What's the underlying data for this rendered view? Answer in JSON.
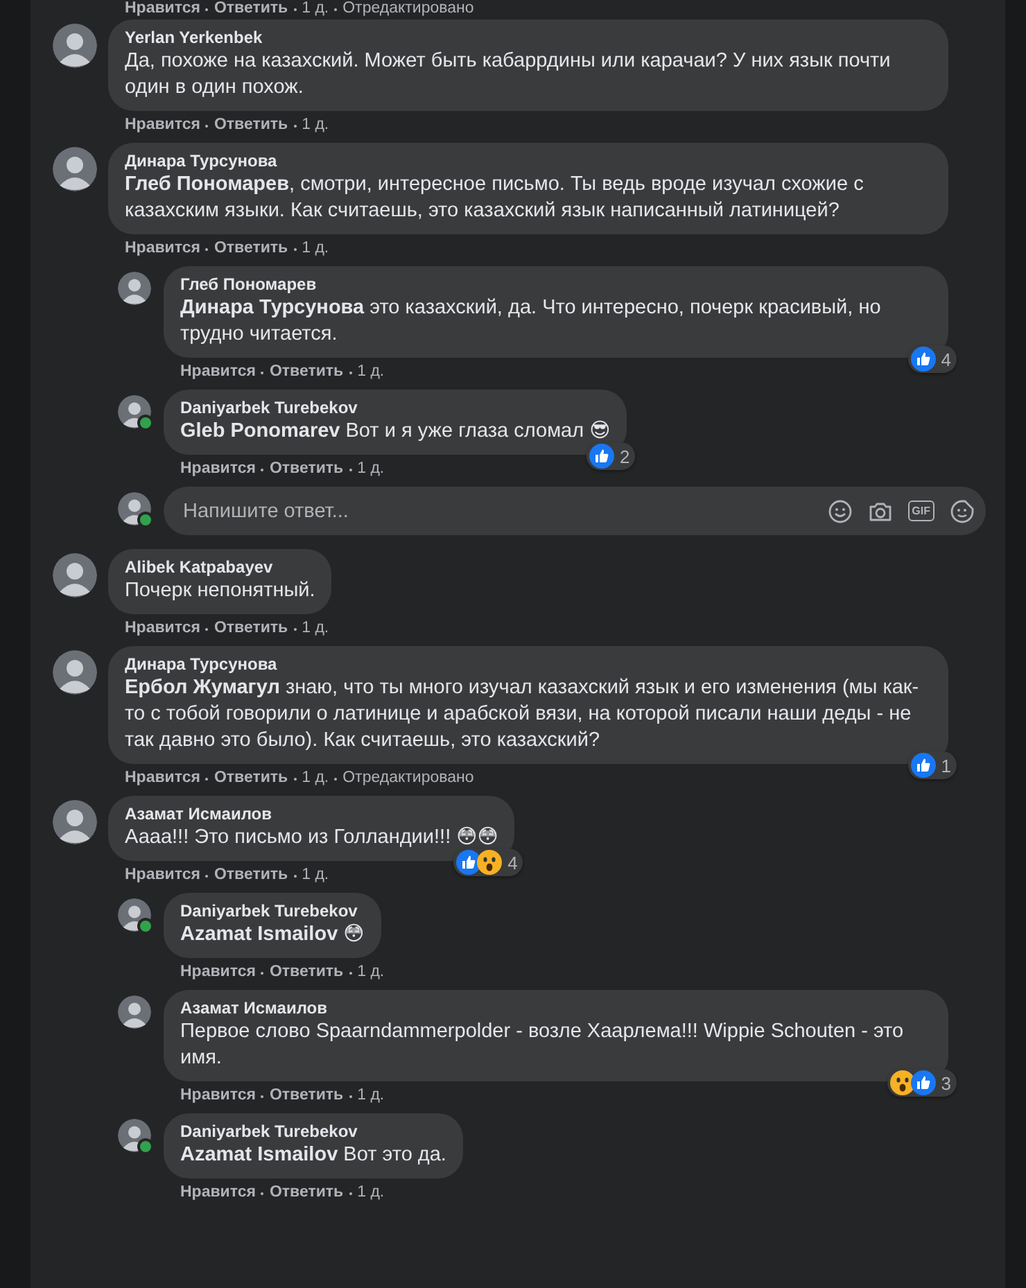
{
  "top_actions": [
    {
      "kind": "like",
      "label": "Нравится"
    },
    {
      "kind": "reply",
      "label": "Ответить"
    },
    {
      "kind": "time",
      "label": "1 д."
    },
    {
      "kind": "edited",
      "label": "Отредактировано"
    }
  ],
  "comments": [
    {
      "kind": "comment",
      "author": "Yerlan Yerkenbek",
      "online": false,
      "text": "Да, похоже на казахский. Может быть кабаррдины или карачаи? У них язык почти один в один похож.",
      "actions": [
        {
          "kind": "like",
          "label": "Нравится"
        },
        {
          "kind": "reply",
          "label": "Ответить"
        },
        {
          "kind": "time",
          "label": "1 д."
        }
      ]
    },
    {
      "kind": "comment",
      "author": "Динара Турсунова",
      "online": false,
      "text": "**Глеб Пономарев**, смотри, интересное письмо. Ты ведь вроде изучал схожие с казахским языки. Как считаешь, это казахский язык написанный латиницей?",
      "actions": [
        {
          "kind": "like",
          "label": "Нравится"
        },
        {
          "kind": "reply",
          "label": "Ответить"
        },
        {
          "kind": "time",
          "label": "1 д."
        }
      ],
      "replies": [
        {
          "kind": "comment",
          "author": "Глеб Пономарев",
          "online": false,
          "text": "**Динара Турсунова** это казахский, да. Что интересно, почерк красивый, но трудно читается.",
          "reactions": {
            "icons": [
              {
                "kind": "like"
              }
            ],
            "count": "4"
          },
          "actions": [
            {
              "kind": "like",
              "label": "Нравится"
            },
            {
              "kind": "reply",
              "label": "Ответить"
            },
            {
              "kind": "time",
              "label": "1 д."
            }
          ]
        },
        {
          "kind": "comment",
          "author": "Daniyarbek Turebekov",
          "online": true,
          "text": "**Gleb Ponomarev** Вот и я уже глаза сломал 😎",
          "reactions": {
            "icons": [
              {
                "kind": "like"
              }
            ],
            "count": "2"
          },
          "actions": [
            {
              "kind": "like",
              "label": "Нравится"
            },
            {
              "kind": "reply",
              "label": "Ответить"
            },
            {
              "kind": "time",
              "label": "1 д."
            }
          ]
        },
        {
          "kind": "reply_box",
          "online": true,
          "placeholder": "Напишите ответ...",
          "gif_label": "GIF"
        }
      ]
    },
    {
      "kind": "comment",
      "author": "Alibek Katpabayev",
      "online": false,
      "text": "Почерк непонятный.",
      "actions": [
        {
          "kind": "like",
          "label": "Нравится"
        },
        {
          "kind": "reply",
          "label": "Ответить"
        },
        {
          "kind": "time",
          "label": "1 д."
        }
      ]
    },
    {
      "kind": "comment",
      "author": "Динара Турсунова",
      "online": false,
      "text": "**Ербол Жумагул** знаю, что ты много изучал казахский язык и его изменения (мы как-то с тобой говорили о латинице и арабской вязи, на которой писали наши деды - не так давно это было). Как считаешь, это казахский?",
      "reactions": {
        "icons": [
          {
            "kind": "like"
          }
        ],
        "count": "1"
      },
      "actions": [
        {
          "kind": "like",
          "label": "Нравится"
        },
        {
          "kind": "reply",
          "label": "Ответить"
        },
        {
          "kind": "time",
          "label": "1 д."
        },
        {
          "kind": "edited",
          "label": "Отредактировано"
        }
      ]
    },
    {
      "kind": "comment",
      "author": "Азамат Исмаилов",
      "online": false,
      "text": "Аааа!!! Это письмо из Голландии!!! 😳😳",
      "reactions": {
        "icons": [
          {
            "kind": "like"
          },
          {
            "kind": "wow"
          }
        ],
        "count": "4"
      },
      "actions": [
        {
          "kind": "like",
          "label": "Нравится"
        },
        {
          "kind": "reply",
          "label": "Ответить"
        },
        {
          "kind": "time",
          "label": "1 д."
        }
      ],
      "replies": [
        {
          "kind": "comment",
          "author": "Daniyarbek Turebekov",
          "online": true,
          "text": "**Azamat Ismailov** 😳",
          "actions": [
            {
              "kind": "like",
              "label": "Нравится"
            },
            {
              "kind": "reply",
              "label": "Ответить"
            },
            {
              "kind": "time",
              "label": "1 д."
            }
          ]
        },
        {
          "kind": "comment",
          "author": "Азамат Исмаилов",
          "online": false,
          "text": "Первое слово Spaarndammerpolder - возле Хаарлема!!! Wippie Schouten - это имя.",
          "reactions": {
            "icons": [
              {
                "kind": "wow"
              },
              {
                "kind": "like"
              }
            ],
            "count": "3"
          },
          "actions": [
            {
              "kind": "like",
              "label": "Нравится"
            },
            {
              "kind": "reply",
              "label": "Ответить"
            },
            {
              "kind": "time",
              "label": "1 д."
            }
          ]
        },
        {
          "kind": "comment",
          "author": "Daniyarbek Turebekov",
          "online": true,
          "text": "**Azamat Ismailov** Вот это да.",
          "actions": [
            {
              "kind": "like",
              "label": "Нравится"
            },
            {
              "kind": "reply",
              "label": "Ответить"
            },
            {
              "kind": "time",
              "label": "1 д."
            }
          ]
        }
      ]
    }
  ]
}
